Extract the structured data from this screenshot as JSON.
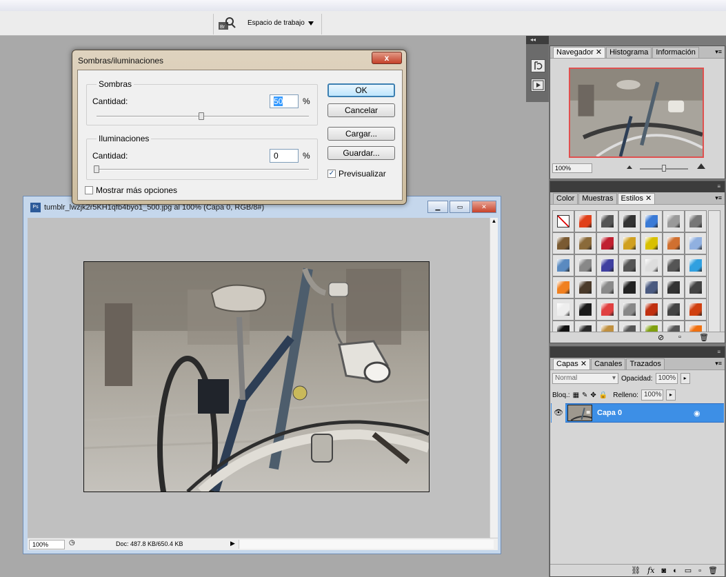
{
  "toolbar": {
    "workspace_label": "Espacio de trabajo"
  },
  "dialog": {
    "title": "Sombras/iluminaciones",
    "close_label": "x",
    "shadows": {
      "group_label": "Sombras",
      "amount_label": "Cantidad:",
      "amount_value": "50",
      "unit": "%",
      "slider_value": 50
    },
    "highlights": {
      "group_label": "Iluminaciones",
      "amount_label": "Cantidad:",
      "amount_value": "0",
      "unit": "%",
      "slider_value": 0
    },
    "more_options_label": "Mostrar más opciones",
    "more_options_checked": false,
    "buttons": {
      "ok": "OK",
      "cancel": "Cancelar",
      "load": "Cargar...",
      "save": "Guardar..."
    },
    "preview_label": "Previsualizar",
    "preview_checked": true
  },
  "document": {
    "title": "tumblr_lwzjk2r5KH1qfb4byo1_500.jpg al 100% (Capa 0, RGB/8#)",
    "zoom": "100%",
    "doc_info": "Doc: 487.8 KB/650.4 KB"
  },
  "navigator_panel": {
    "tabs": [
      "Navegador",
      "Histograma",
      "Información"
    ],
    "active_tab": "Navegador",
    "zoom": "100%"
  },
  "styles_panel": {
    "tabs": [
      "Color",
      "Muestras",
      "Estilos"
    ],
    "active_tab": "Estilos",
    "swatch_colors": [
      "#ffffff",
      "#e0401a",
      "#555555",
      "#333333",
      "#3a7ad6",
      "#9a9a9a",
      "#777777",
      "#7a5a32",
      "#8a6a3a",
      "#c02030",
      "#d0a020",
      "#d8c000",
      "#d07030",
      "#90b0e0",
      "#5a8ac0",
      "#888888",
      "#4040a0",
      "#555555",
      "#dddddd",
      "#555555",
      "#30a0e0",
      "#f08020",
      "#4a3a2a",
      "#8a8a8a",
      "#222222",
      "#4a5a80",
      "#333333",
      "#444444",
      "#eeeeee",
      "#1a1a1a",
      "#e04040",
      "#888888",
      "#c03010",
      "#444444",
      "#d04010",
      "#111111",
      "#2a2a2a",
      "#c09040",
      "#555555",
      "#80a010",
      "#555555",
      "#f07010"
    ]
  },
  "layers_panel": {
    "tabs": [
      "Capas",
      "Canales",
      "Trazados"
    ],
    "active_tab": "Capas",
    "blend_mode": "Normal",
    "opacity_label": "Opacidad:",
    "opacity_value": "100%",
    "lock_label": "Bloq.:",
    "fill_label": "Relleno:",
    "fill_value": "100%",
    "layers": [
      {
        "name": "Capa 0",
        "visible": true
      }
    ]
  }
}
